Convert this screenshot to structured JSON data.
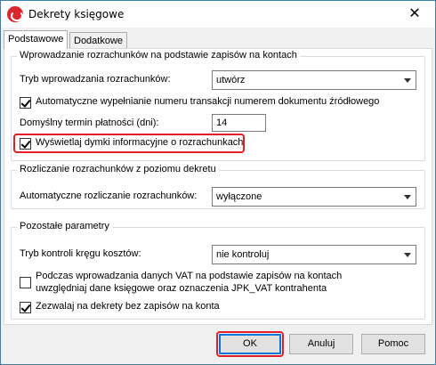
{
  "window": {
    "title": "Dekrety księgowe",
    "close_glyph": "✕",
    "icon": "app-logo-icon"
  },
  "tabs": [
    {
      "label": "Podstawowe",
      "active": true
    },
    {
      "label": "Dodatkowe",
      "active": false
    }
  ],
  "group1": {
    "legend": "Wprowadzanie rozrachunków na podstawie zapisów na kontach",
    "tryb_label": "Tryb wprowadzania rozrachunków:",
    "tryb_value": "utwórz",
    "auto_numer_label": "Automatyczne wypełnianie numeru transakcji numerem dokumentu źródłowego",
    "auto_numer_checked": true,
    "termin_label": "Domyślny termin płatności (dni):",
    "termin_value": "14",
    "dymki_label": "Wyświetlaj dymki informacyjne o rozrachunkach",
    "dymki_checked": true
  },
  "group2": {
    "legend": "Rozliczanie rozrachunków z poziomu dekretu",
    "auto_rozl_label": "Automatyczne rozliczanie rozrachunków:",
    "auto_rozl_value": "wyłączone"
  },
  "group3": {
    "legend": "Pozostałe parametry",
    "kontrola_label": "Tryb kontroli kręgu kosztów:",
    "kontrola_value": "nie kontroluj",
    "vat_label_line1": "Podczas wprowadzania danych VAT na podstawie zapisów na kontach",
    "vat_label_line2": "uwzględniaj dane księgowe oraz oznaczenia JPK_VAT kontrahenta",
    "vat_checked": false,
    "bez_zapisow_label": "Zezwalaj na dekrety bez zapisów na konta",
    "bez_zapisow_checked": true
  },
  "buttons": {
    "ok": "OK",
    "cancel": "Anuluj",
    "help": "Pomoc"
  },
  "accent": {
    "highlight": "#e31f2b",
    "focus": "#0078d7"
  }
}
